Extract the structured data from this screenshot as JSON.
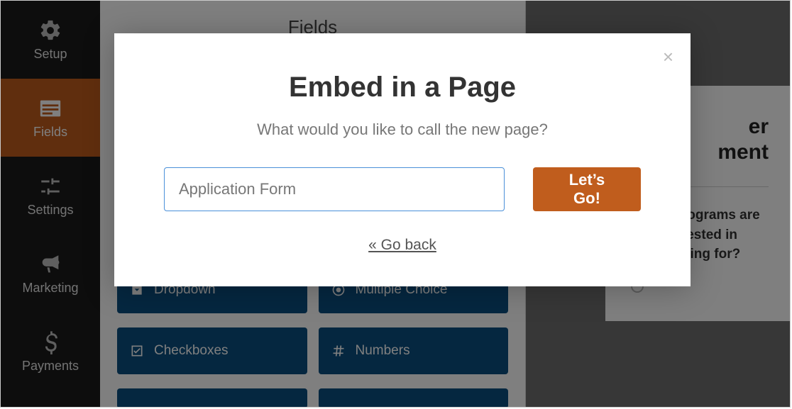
{
  "sidebar": {
    "items": [
      {
        "id": "setup",
        "label": "Setup"
      },
      {
        "id": "fields",
        "label": "Fields"
      },
      {
        "id": "settings",
        "label": "Settings"
      },
      {
        "id": "marketing",
        "label": "Marketing"
      },
      {
        "id": "payments",
        "label": "Payments"
      }
    ],
    "active": "fields"
  },
  "builder": {
    "header": "Fields",
    "fields": [
      {
        "icon": "caret-square",
        "label": "Dropdown"
      },
      {
        "icon": "radio-dot",
        "label": "Multiple Choice"
      },
      {
        "icon": "check-square",
        "label": "Checkboxes"
      },
      {
        "icon": "hash",
        "label": "Numbers"
      }
    ]
  },
  "preview": {
    "title_line1": "er",
    "title_line2": "ment",
    "question": "Which programs are you interested in volunteering for?"
  },
  "modal": {
    "title": "Embed in a Page",
    "subtitle": "What would you like to call the new page?",
    "input_value": "Application Form",
    "go_label": "Let’s Go!",
    "back_label": "« Go back",
    "close_label": "×"
  }
}
